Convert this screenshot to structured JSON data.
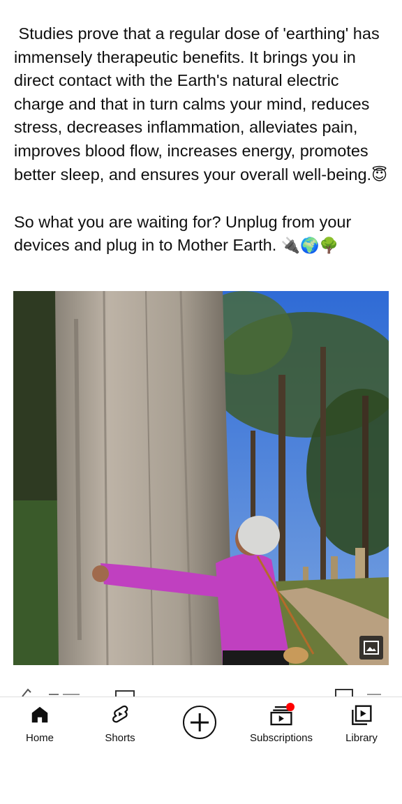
{
  "post": {
    "paragraph1": " Studies prove that a regular dose of 'earthing' has immensely therapeutic benefits. It brings you in direct contact with the Earth's natural electric charge and that in turn calms your mind, reduces stress, decreases inflammation, alleviates pain, improves blood flow, increases energy, promotes better sleep, and ensures your overall well-being.",
    "paragraph1_emoji": "😇",
    "paragraph2": "So what you are waiting for? Unplug from your devices and plug in to Mother Earth. ",
    "paragraph2_emojis": "🔌🌍🌳"
  },
  "image": {
    "subject": "woman in pink sweater hugging large tree trunk",
    "badge_icon": "image-gallery-icon"
  },
  "colors": {
    "text": "#0f0f0f",
    "accent_red": "#ff0000",
    "sweater": "#c040c0",
    "sky": "#3f78d8"
  },
  "bottom_nav": {
    "items": [
      {
        "label": "Home",
        "icon": "home-icon"
      },
      {
        "label": "Shorts",
        "icon": "shorts-icon"
      },
      {
        "label": "",
        "icon": "create-plus-icon"
      },
      {
        "label": "Subscriptions",
        "icon": "subscriptions-icon"
      },
      {
        "label": "Library",
        "icon": "library-icon"
      }
    ]
  }
}
